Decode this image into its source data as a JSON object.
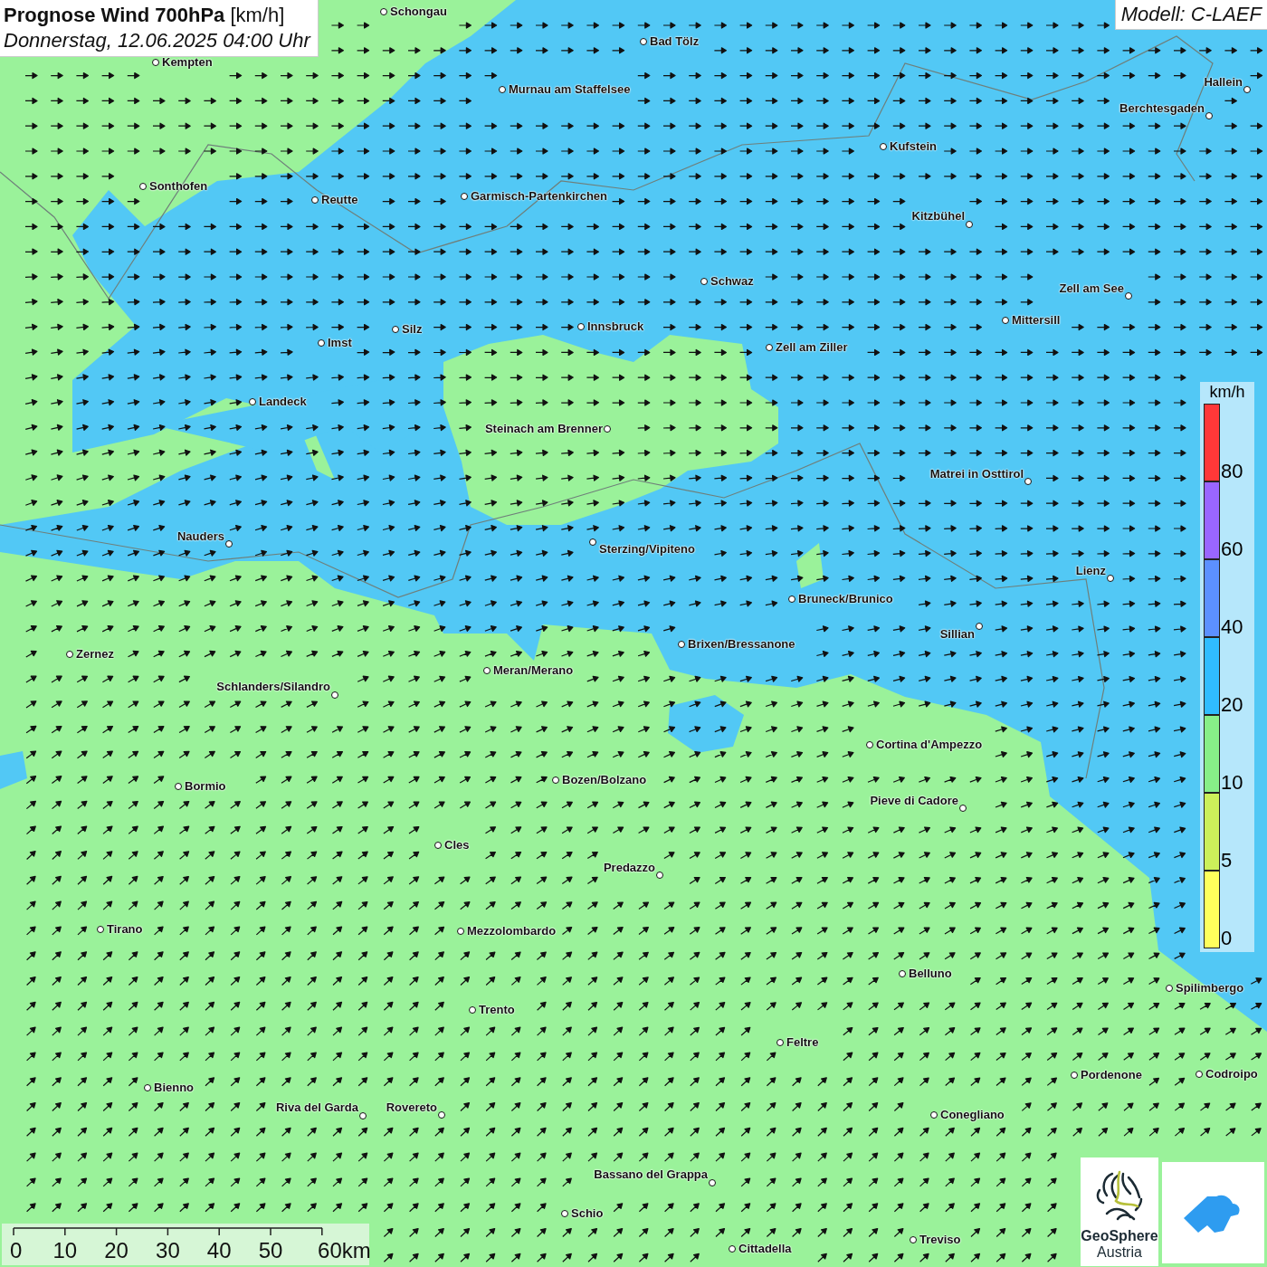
{
  "title": {
    "heading": "**Prognose Wind 700hPa** [km/h]",
    "subtitle": "Donnerstag, 12.06.2025 04:00 Uhr"
  },
  "model_label": "Modell: C-LAEF",
  "map": {
    "places": [
      "Schongau",
      "Bad Tölz",
      "Kempten",
      "Murnau am Staffelsee",
      "Hallein",
      "Berchtesgaden",
      "Kufstein",
      "Sonthofen",
      "Reutte",
      "Garmisch-Partenkirchen",
      "Kitzbühel",
      "Schwaz",
      "Zell am See",
      "Mittersill",
      "Innsbruck",
      "Imst",
      "Silz",
      "Zell am Ziller",
      "Landeck",
      "Steinach am Brenner",
      "Matrei in Osttirol",
      "Nauders",
      "Sterzing/Vipiteno",
      "Lienz",
      "Bruneck/Brunico",
      "Sillian",
      "Brixen/Bressanone",
      "Zernez",
      "Meran/Merano",
      "Schlanders/Silandro",
      "Cortina d'Ampezzo",
      "Bozen/Bolzano",
      "Bormio",
      "Pieve di Cadore",
      "Cles",
      "Predazzo",
      "Tirano",
      "Mezzolombardo",
      "Belluno",
      "Spilimbergo",
      "Trento",
      "Feltre",
      "Pordenone",
      "Codroipo",
      "Bienno",
      "Riva del Garda",
      "Rovereto",
      "Conegliano",
      "Bassano del Grappa",
      "Schio",
      "Treviso",
      "Cittadella"
    ]
  },
  "legend": {
    "unit": "km/h",
    "bins": [
      {
        "color": "#ff3838",
        "label": "80"
      },
      {
        "color": "#9a66ff",
        "label": "60"
      },
      {
        "color": "#5c90ff",
        "label": "40"
      },
      {
        "color": "#30bcff",
        "label": "20"
      },
      {
        "color": "#88ef88",
        "label": "10"
      },
      {
        "color": "#ccf05a",
        "label": "5"
      },
      {
        "color": "#ffff5c",
        "label": "0"
      }
    ]
  },
  "scale_bar": {
    "labels": [
      "0",
      "10",
      "20",
      "30",
      "40",
      "50",
      "60km"
    ]
  },
  "logos": {
    "name": "GeoSphere",
    "subtitle": "Austria"
  }
}
